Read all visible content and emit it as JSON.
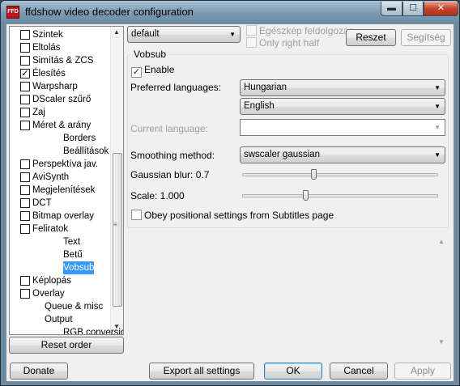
{
  "window": {
    "title": "ffdshow video decoder configuration",
    "app_icon_text": "FFD"
  },
  "tree": {
    "items": [
      {
        "label": "Szintek",
        "checkbox": true,
        "checked": false,
        "indent": 0
      },
      {
        "label": "Eltolás",
        "checkbox": true,
        "checked": false,
        "indent": 0
      },
      {
        "label": "Simítás & ZCS",
        "checkbox": true,
        "checked": false,
        "indent": 0
      },
      {
        "label": "Élesítés",
        "checkbox": true,
        "checked": true,
        "indent": 0
      },
      {
        "label": "Warpsharp",
        "checkbox": true,
        "checked": false,
        "indent": 0
      },
      {
        "label": "DScaler szűrő",
        "checkbox": true,
        "checked": false,
        "indent": 0
      },
      {
        "label": "Zaj",
        "checkbox": true,
        "checked": false,
        "indent": 0
      },
      {
        "label": "Méret & arány",
        "checkbox": true,
        "checked": false,
        "indent": 0
      },
      {
        "label": "Borders",
        "checkbox": false,
        "checked": false,
        "indent": 2
      },
      {
        "label": "Beállítások",
        "checkbox": false,
        "checked": false,
        "indent": 2
      },
      {
        "label": "Perspektíva jav.",
        "checkbox": true,
        "checked": false,
        "indent": 0
      },
      {
        "label": "AviSynth",
        "checkbox": true,
        "checked": false,
        "indent": 0
      },
      {
        "label": "Megjelenítések",
        "checkbox": true,
        "checked": false,
        "indent": 0
      },
      {
        "label": "DCT",
        "checkbox": true,
        "checked": false,
        "indent": 0
      },
      {
        "label": "Bitmap overlay",
        "checkbox": true,
        "checked": false,
        "indent": 0
      },
      {
        "label": "Feliratok",
        "checkbox": true,
        "checked": false,
        "indent": 0
      },
      {
        "label": "Text",
        "checkbox": false,
        "checked": false,
        "indent": 2
      },
      {
        "label": "Betű",
        "checkbox": false,
        "checked": false,
        "indent": 2
      },
      {
        "label": "Vobsub",
        "checkbox": false,
        "checked": false,
        "indent": 2,
        "selected": true
      },
      {
        "label": "Képlopás",
        "checkbox": true,
        "checked": false,
        "indent": 0
      },
      {
        "label": "Overlay",
        "checkbox": true,
        "checked": false,
        "indent": 0
      },
      {
        "label": "Queue & misc",
        "checkbox": false,
        "checked": false,
        "indent": 1
      },
      {
        "label": "Output",
        "checkbox": false,
        "checked": false,
        "indent": 1
      },
      {
        "label": "RGB conversion",
        "checkbox": false,
        "checked": false,
        "indent": 2
      }
    ]
  },
  "top": {
    "preset_value": "default",
    "fullscreen_label": "Egészkép feldolgozás",
    "only_right_half_label": "Only right half",
    "reset_label": "Reszet",
    "help_label": "Segítség"
  },
  "vobsub": {
    "group_title": "Vobsub",
    "enable_label": "Enable",
    "enable_checked": true,
    "preferred_languages_label": "Preferred languages:",
    "preferred_language_1": "Hungarian",
    "preferred_language_2": "English",
    "current_language_label": "Current language:",
    "current_language_value": "",
    "smoothing_method_label": "Smoothing method:",
    "smoothing_method_value": "swscaler gaussian",
    "gaussian_blur_label": "Gaussian blur: 0.7",
    "gaussian_blur_level": 0.36,
    "scale_label": "Scale: 1.000",
    "scale_level": 0.32,
    "obey_label": "Obey positional settings from Subtitles page",
    "obey_checked": false
  },
  "bottom": {
    "reset_order_label": "Reset order",
    "donate_label": "Donate",
    "export_label": "Export all settings",
    "ok_label": "OK",
    "cancel_label": "Cancel",
    "apply_label": "Apply"
  },
  "glyphs": {
    "minimize": "▬",
    "maximize": "☐",
    "close": "✕",
    "dropdown": "▼",
    "check": "✓",
    "scroll_up": "▲",
    "scroll_down": "▼",
    "grip": "≡"
  }
}
